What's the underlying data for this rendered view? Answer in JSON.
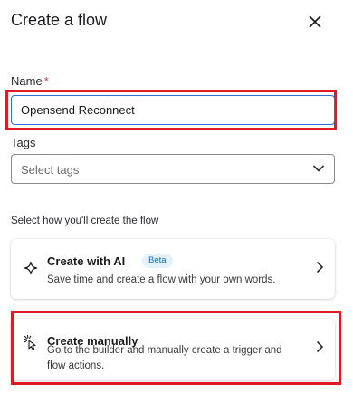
{
  "header": {
    "title": "Create a flow",
    "close_icon": "close-icon"
  },
  "name_field": {
    "label": "Name",
    "required_marker": "*",
    "value": "Opensend Reconnect"
  },
  "tags_field": {
    "label": "Tags",
    "placeholder": "Select tags"
  },
  "create_section": {
    "label": "Select how you'll create the flow",
    "options": [
      {
        "title": "Create with AI",
        "badge": "Beta",
        "description": "Save time and create a flow with your own words.",
        "icon": "sparkle-icon"
      },
      {
        "title": "Create manually",
        "description": "Go to the builder and manually create a trigger and flow actions.",
        "icon": "cursor-click-icon"
      }
    ]
  },
  "colors": {
    "highlight": "#e01a25",
    "focus_border": "#2f6fd8",
    "required": "#d13438",
    "badge_bg": "#e5f1fb",
    "badge_text": "#0f6cbd"
  }
}
